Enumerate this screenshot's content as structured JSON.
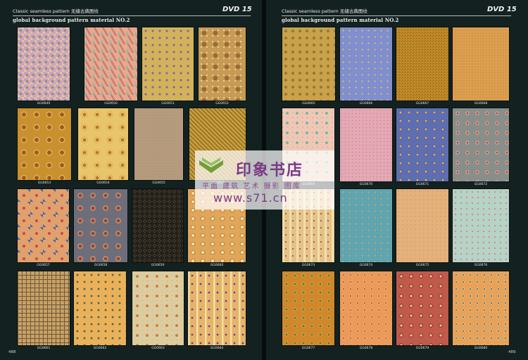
{
  "header": {
    "series_title": "Classic seamless pattern 无缝古典图纹",
    "dvd_label": "DVD",
    "dvd_number": "15",
    "subtitle": "global background pattern material NO.2"
  },
  "left_page": {
    "page_number": "488",
    "codes": [
      "GG0649",
      "GG0650",
      "GG0651",
      "GG0652",
      "GG0653",
      "GG0654",
      "GG0655",
      "GG0656",
      "GG0657",
      "GG0658",
      "GG0659",
      "GG0660",
      "GG0661",
      "GG0662",
      "GG0663",
      "GG0664"
    ]
  },
  "right_page": {
    "page_number": "489",
    "codes": [
      "GG0665",
      "GG0666",
      "GG0667",
      "GG0668",
      "GG0669",
      "GG0670",
      "GG0671",
      "GG0672",
      "GG0673",
      "GG0674",
      "GG0675",
      "GG0676",
      "GG0677",
      "GG0678",
      "GG0679",
      "GG0680"
    ]
  },
  "watermark": {
    "brand": "印象书店",
    "tagline": "平面 建筑 艺术 摄影 图库",
    "url": "www.s71.cn"
  }
}
